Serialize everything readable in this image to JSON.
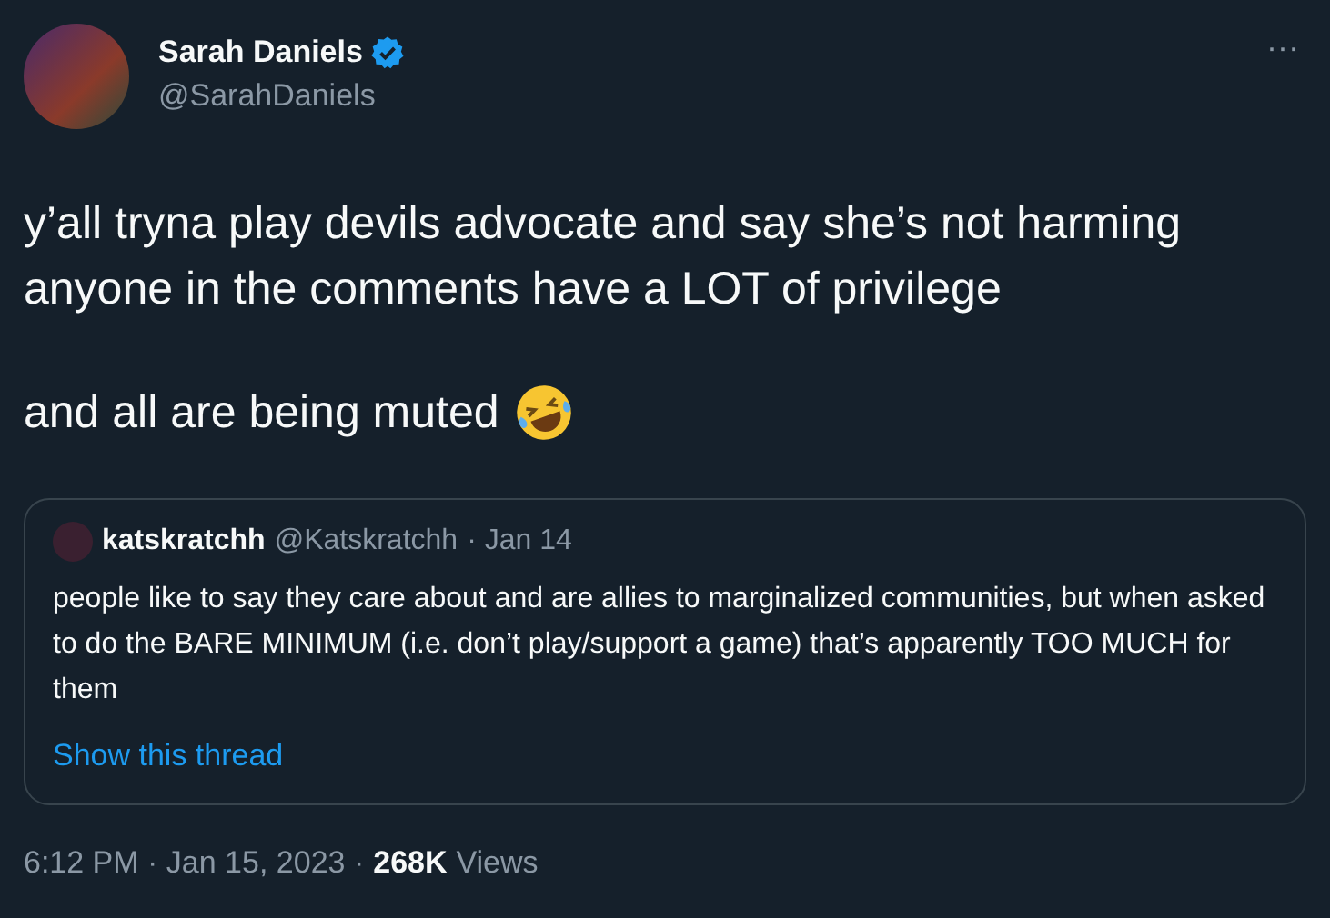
{
  "author": {
    "name": "Sarah Daniels",
    "verified": true,
    "handle": "@SarahDaniels"
  },
  "more": "···",
  "paragraphs": [
    "y’all tryna play devils advocate and say she’s not harming anyone in the comments have a LOT of privilege",
    "and all are being muted"
  ],
  "quote": {
    "name": "katskratchh",
    "handle": "@Katskratchh",
    "date": "· Jan 14",
    "text": "people like to say they care about and are allies to marginalized communities, but when asked to do the BARE MINIMUM (i.e. don’t play/support a game) that’s apparently TOO MUCH for them",
    "link": "Show this thread"
  },
  "meta": {
    "time": "6:12 PM · Jan 15, 2023 ·",
    "views_count": "268K",
    "views_label": "Views"
  }
}
